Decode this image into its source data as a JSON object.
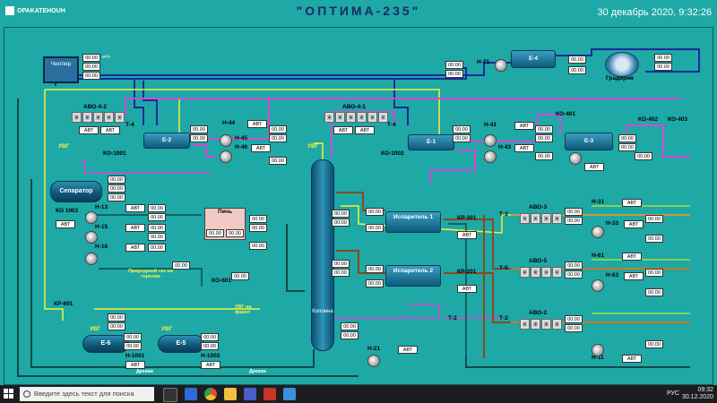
{
  "header": {
    "brand": "OPAKATEHOUH",
    "title": "\"ОПТИМА-235\"",
    "datetime": "30 декабрь 2020, 9:32:26"
  },
  "colors": {
    "background": "#1ea8a6",
    "pipe_magenta": "#d548d8",
    "pipe_yellow": "#f6ef3a",
    "pipe_blue": "#1b2a9a",
    "pipe_brown": "#8a4a1a",
    "pipe_orange": "#e08a2a",
    "pipe_green": "#a2e040"
  },
  "equipment": {
    "chiller": "Чиллер",
    "e4": "Е-4",
    "gradirnya": "Градирня",
    "avo42": "АВО-4-2",
    "avo41": "АВО-4-1",
    "e2": "Е-2",
    "e1": "Е-1",
    "e3": "Е-3",
    "t4a": "Т-4",
    "t4b": "Т-4",
    "separator": "Сепаратор",
    "pech": "Печь",
    "isp1": "Испаритель 1",
    "isp2": "Испаритель 2",
    "kolonna": "Колонна",
    "avo3": "АВО-3",
    "avo5": "АВО-5",
    "avo2": "АВО-2",
    "t3": "Т-3",
    "t5": "Т-5",
    "t2a": "Т-2",
    "t2b": "Т-2",
    "e6": "Е-6",
    "e5": "Е-5",
    "ko1001": "КО-1001",
    "ko1002": "КО-1002",
    "ko1003": "КО 1003",
    "ko401": "КО-401",
    "ko402": "КО-402",
    "ko403": "КО-403",
    "ko601": "КО-601",
    "kr601": "КР-601",
    "kr301": "КР-301",
    "kr201": "КР-201",
    "h71": "Н-71",
    "h44": "Н-44",
    "h45": "Н-45",
    "h46": "Н-46",
    "h41": "Н-41",
    "h42": "Н-42",
    "h43": "Н-43",
    "h47": "Н-47",
    "h31": "Н-31",
    "h33": "Н-33",
    "h61": "Н-61",
    "h63": "Н-63",
    "h11": "Н-11",
    "h13": "Н-13",
    "h15": "Н-15",
    "h16": "Н-16",
    "h21": "Н-21",
    "h1001": "Н-1001",
    "h1002": "Н-1002",
    "pg": "Природный газ на горелки",
    "ubg_fakel": "УВГ на факел",
    "ubg": "УВГ",
    "drenazh": "Дренаж",
    "avt": "АВТ"
  },
  "readings": {
    "value": "00.00",
    "unit_m3": "м³/ч",
    "unit_pct": "%",
    "unit_c": "°С",
    "unit_mpa": "МПа"
  },
  "taskbar": {
    "search_placeholder": "Введите здесь текст для поиска",
    "lang": "РУС",
    "time": "09:32",
    "date": "30.12.2020"
  }
}
